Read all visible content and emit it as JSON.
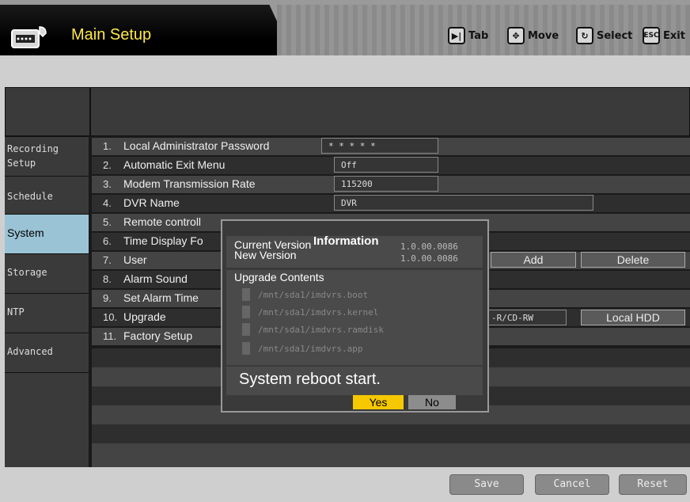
{
  "header": {
    "title": "Main Setup",
    "hints": [
      {
        "icon": "tab-icon",
        "glyph": "▶|",
        "label": "Tab"
      },
      {
        "icon": "move-icon",
        "glyph": "✥",
        "label": "Move"
      },
      {
        "icon": "select-icon",
        "glyph": "↻",
        "label": "Select"
      },
      {
        "icon": "esc-icon",
        "glyph": "ESC",
        "label": "Exit"
      }
    ]
  },
  "sidebar": {
    "items": [
      {
        "label": "Recording Setup"
      },
      {
        "label": "Schedule"
      },
      {
        "label": "System"
      },
      {
        "label": "Storage"
      },
      {
        "label": "NTP"
      },
      {
        "label": "Advanced"
      }
    ]
  },
  "settings": [
    {
      "num": "1.",
      "label": "Local Administrator Password",
      "value": "* * * * *"
    },
    {
      "num": "2.",
      "label": "Automatic Exit Menu",
      "value": "Off"
    },
    {
      "num": "3.",
      "label": "Modem Transmission Rate",
      "value": "115200"
    },
    {
      "num": "4.",
      "label": "DVR Name",
      "value": "DVR"
    },
    {
      "num": "5.",
      "label": "Remote controll"
    },
    {
      "num": "6.",
      "label": "Time Display Fo"
    },
    {
      "num": "7.",
      "label": "User",
      "add_label": "Add",
      "delete_label": "Delete"
    },
    {
      "num": "8.",
      "label": "Alarm Sound"
    },
    {
      "num": "9.",
      "label": "Set Alarm Time"
    },
    {
      "num": "10.",
      "label": "Upgrade",
      "media_value": "-R/CD-RW",
      "local_label": "Local HDD"
    },
    {
      "num": "11.",
      "label": "Factory Setup"
    }
  ],
  "dialog": {
    "title": "Information",
    "current_version_label": "Current Version",
    "current_version": "1.0.00.0086",
    "new_version_label": "New Version",
    "new_version": "1.0.00.0086",
    "upgrade_contents_label": "Upgrade Contents",
    "files": [
      "/mnt/sda1/imdvrs.boot",
      "/mnt/sda1/imdvrs.kernel",
      "/mnt/sda1/imdvrs.ramdisk",
      "/mnt/sda1/imdvrs.app"
    ],
    "message": "System reboot start.",
    "yes_label": "Yes",
    "no_label": "No"
  },
  "footer": {
    "save_label": "Save",
    "cancel_label": "Cancel",
    "reset_label": "Reset"
  },
  "colors": {
    "title": "#ffe94a",
    "selected_tab": "#9ac4d6",
    "yes_button": "#f5c800"
  }
}
